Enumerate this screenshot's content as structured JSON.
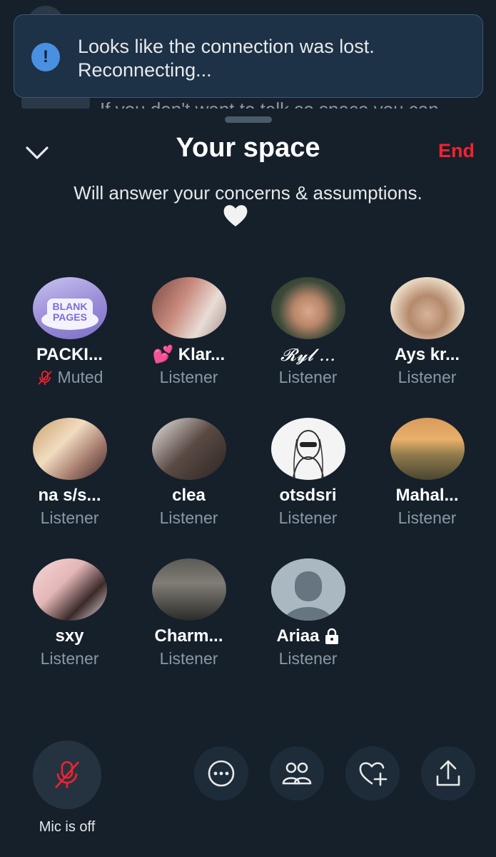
{
  "background": {
    "snippet": "If you don't want to talk so space you can"
  },
  "toast": {
    "icon": "alert-icon",
    "line1": "Looks like the connection was lost.",
    "line2": "Reconnecting..."
  },
  "header": {
    "title": "Your space",
    "end_label": "End",
    "collapse_icon": "chevron-down-icon"
  },
  "description": "Will answer your concerns & assumptions.",
  "participants": [
    {
      "name": "PACKI...",
      "role": "Muted",
      "muted": true,
      "avatar_text": "BLANK PAGES"
    },
    {
      "name": "Klar...",
      "role": "Listener",
      "prefix_emoji": "💕"
    },
    {
      "name": "𝓡𝔂𝓵 ...",
      "role": "Listener"
    },
    {
      "name": "Ays kr...",
      "role": "Listener"
    },
    {
      "name": "na s/s...",
      "role": "Listener"
    },
    {
      "name": "clea",
      "role": "Listener"
    },
    {
      "name": "otsdsri",
      "role": "Listener"
    },
    {
      "name": "Mahal...",
      "role": "Listener"
    },
    {
      "name": "sxy",
      "role": "Listener"
    },
    {
      "name": "Charm...",
      "role": "Listener"
    },
    {
      "name": "Ariaa",
      "role": "Listener",
      "locked": true
    }
  ],
  "bottom_bar": {
    "mic_label": "Mic is off",
    "actions": [
      "more-icon",
      "people-icon",
      "heart-add-icon",
      "share-icon"
    ]
  },
  "colors": {
    "accent_red": "#f4212e",
    "sheet_bg": "#15202b",
    "toast_bg": "#1d3147",
    "toast_icon": "#4a90e2",
    "muted_text": "#8b98a5"
  }
}
